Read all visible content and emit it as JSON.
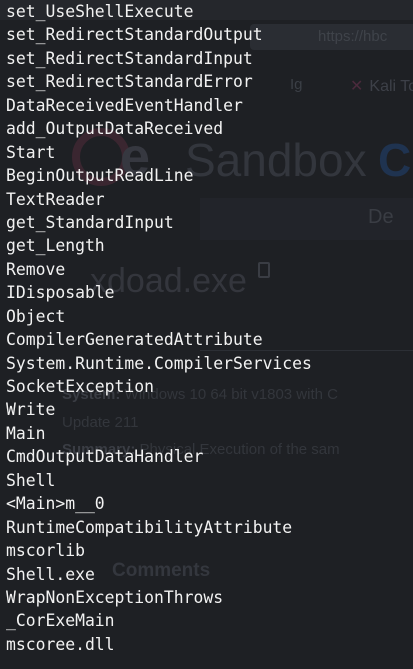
{
  "background_page": {
    "url_fragment": "https://hbc",
    "bookmark_text": "Ig",
    "bookmark_kali": "Kali To",
    "logo_e": "e",
    "logo_text": "Sandbox",
    "logo_suffix": "C",
    "nav_item": "De",
    "file_name": "xdoad.exe",
    "system_label": "System:",
    "system_value": "Windows 10 64 bit v1803 with C",
    "update_line": "Update 211",
    "summary_label": "Summary:",
    "summary_value": "Physical Execution of the sam",
    "comments_heading": "Comments"
  },
  "strings": [
    "set_UseShellExecute",
    "set_RedirectStandardOutput",
    "set_RedirectStandardInput",
    "set_RedirectStandardError",
    "DataReceivedEventHandler",
    "add_OutputDataReceived",
    "Start",
    "BeginOutputReadLine",
    "TextReader",
    "get_StandardInput",
    "get_Length",
    "Remove",
    "IDisposable",
    "Object",
    "CompilerGeneratedAttribute",
    "System.Runtime.CompilerServices",
    "SocketException",
    "Write",
    "Main",
    "CmdOutputDataHandler",
    "Shell",
    "<Main>m__0",
    "RuntimeCompatibilityAttribute",
    "mscorlib",
    "Shell.exe",
    "WrapNonExceptionThrows",
    "_CorExeMain",
    "mscoree.dll"
  ]
}
